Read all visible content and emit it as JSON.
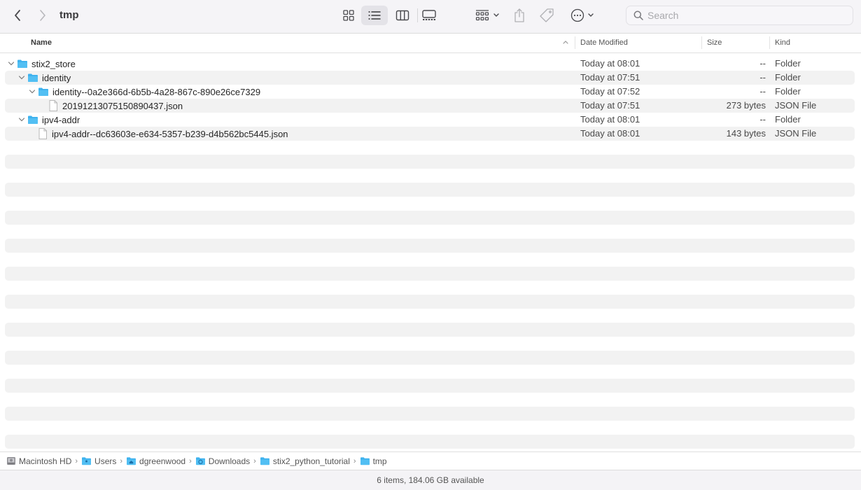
{
  "window": {
    "title": "tmp"
  },
  "toolbar": {
    "back_icon": "chevron-left-icon",
    "forward_icon": "chevron-right-icon",
    "views": [
      {
        "name": "icon-view",
        "icon": "grid-icon",
        "active": false
      },
      {
        "name": "list-view",
        "icon": "list-icon",
        "active": true
      },
      {
        "name": "column-view",
        "icon": "columns-icon",
        "active": false
      },
      {
        "name": "gallery-view",
        "icon": "gallery-icon",
        "active": false
      }
    ],
    "group_icon": "group-by-icon",
    "share_icon": "share-icon",
    "tag_icon": "tag-icon",
    "more_icon": "ellipsis-circle-icon",
    "search_placeholder": "Search",
    "search_value": ""
  },
  "columns": {
    "name": "Name",
    "date": "Date Modified",
    "size": "Size",
    "kind": "Kind",
    "sort_indicator": "^"
  },
  "files": [
    {
      "name": "stix2_store",
      "type": "folder",
      "depth": 0,
      "expanded": true,
      "date": "Today at 08:01",
      "size": "--",
      "kind": "Folder"
    },
    {
      "name": "identity",
      "type": "folder",
      "depth": 1,
      "expanded": true,
      "date": "Today at 07:51",
      "size": "--",
      "kind": "Folder"
    },
    {
      "name": "identity--0a2e366d-6b5b-4a28-867c-890e26ce7329",
      "type": "folder",
      "depth": 2,
      "expanded": true,
      "date": "Today at 07:52",
      "size": "--",
      "kind": "Folder"
    },
    {
      "name": "20191213075150890437.json",
      "type": "file",
      "depth": 3,
      "date": "Today at 07:51",
      "size": "273 bytes",
      "kind": "JSON File"
    },
    {
      "name": "ipv4-addr",
      "type": "folder",
      "depth": 1,
      "expanded": true,
      "date": "Today at 08:01",
      "size": "--",
      "kind": "Folder"
    },
    {
      "name": "ipv4-addr--dc63603e-e634-5357-b239-d4b562bc5445.json",
      "type": "file",
      "depth": 2,
      "date": "Today at 08:01",
      "size": "143 bytes",
      "kind": "JSON File"
    }
  ],
  "pathbar": [
    {
      "label": "Macintosh HD",
      "icon": "hard-drive-icon"
    },
    {
      "label": "Users",
      "icon": "folder-icon"
    },
    {
      "label": "dgreenwood",
      "icon": "home-folder-icon"
    },
    {
      "label": "Downloads",
      "icon": "downloads-folder-icon"
    },
    {
      "label": "stix2_python_tutorial",
      "icon": "folder-icon"
    },
    {
      "label": "tmp",
      "icon": "folder-icon"
    }
  ],
  "status": {
    "text": "6 items, 184.06 GB available"
  },
  "colors": {
    "folder": "#3eb2ee",
    "stripe": "#f2f2f2",
    "toolbar_bg": "#f5f4f7"
  }
}
